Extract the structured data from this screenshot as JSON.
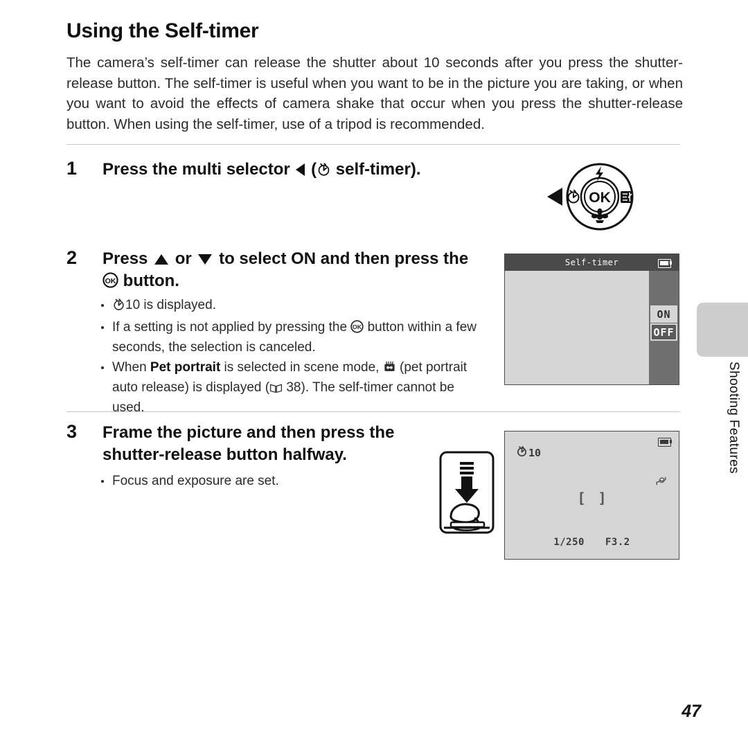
{
  "page": {
    "title": "Using the Self-timer",
    "intro": "The camera’s self-timer can release the shutter about 10 seconds after you press the shutter-release button. The self-timer is useful when you want to be in the picture you are taking, or when you want to avoid the effects of camera shake that occur when you press the shutter-release button. When using the self-timer, use of a tripod is recommended.",
    "page_number": "47",
    "side_tab_label": "Shooting Features"
  },
  "steps": [
    {
      "number": "1",
      "text_before_icon": "Press the multi selector ",
      "text_mid": " (",
      "text_after": " self-timer).",
      "icons": [
        "left-triangle-icon",
        "self-timer-icon"
      ]
    },
    {
      "number": "2",
      "line1_a": "Press ",
      "line1_b": " or ",
      "line1_c": " to select ",
      "line1_bold": "ON",
      "line1_d": " and then press the",
      "line2": " button.",
      "bullets": {
        "b1_text": "10 is displayed.",
        "b2_a": "If a setting is not applied by pressing the ",
        "b2_b": " button within a few seconds, the selection is canceled.",
        "b3_a": "When ",
        "b3_bold": "Pet portrait",
        "b3_b": " is selected in scene mode, ",
        "b3_c": " (pet portrait auto release) is displayed (",
        "b3_page": " 38). The self-timer cannot be used."
      }
    },
    {
      "number": "3",
      "heading": "Frame the picture and then press the shutter-release button halfway.",
      "bullet": "Focus and exposure are set."
    }
  ],
  "multi_selector": {
    "center_label": "OK",
    "top_icon": "flash-icon",
    "left_icon": "self-timer-icon",
    "right_icon": "exposure-compensation-icon",
    "bottom_icon": "macro-flower-icon",
    "press_arrow_icon": "left-triangle-icon"
  },
  "screen_menu": {
    "header_title": "Self-timer",
    "battery_icon": "battery-icon",
    "options": [
      {
        "label": "ON",
        "selected": false
      },
      {
        "label": "OFF",
        "selected": true
      }
    ]
  },
  "screen_live": {
    "self_timer_value": "10",
    "self_timer_icon": "self-timer-icon",
    "battery_icon": "battery-icon",
    "blur_icon": "camera-shake-icon",
    "focus_bracket_left": "[",
    "focus_bracket_right": "]",
    "shutter_speed": "1/250",
    "aperture": "F3.2"
  },
  "shutter_illustration": {
    "icon": "press-shutter-halfway-icon"
  },
  "colors": {
    "text": "#1a1a1a",
    "rule": "#c9c9c9",
    "screen_bg": "#d6d6d6",
    "screen_header": "#4a4a4a",
    "screen_sidebar": "#707070",
    "tab_gray": "#cdcdcd"
  }
}
